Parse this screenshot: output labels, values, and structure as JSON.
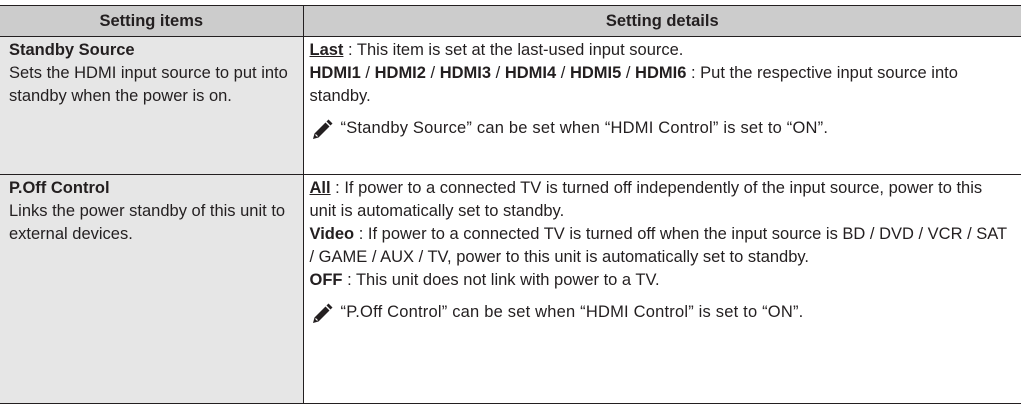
{
  "header": {
    "col_items": "Setting items",
    "col_details": "Setting details"
  },
  "rows": [
    {
      "name": "Standby Source",
      "description": "Sets the HDMI input source to put into standby when the power is on.",
      "details": {
        "last_label": "Last",
        "last_text": " : This item is set at the last-used input source.",
        "hdmi_options": [
          "HDMI1",
          "HDMI2",
          "HDMI3",
          "HDMI4",
          "HDMI5",
          "HDMI6"
        ],
        "hdmi_separator": " / ",
        "hdmi_text": " : Put the respective input source into standby."
      },
      "note": "“Standby Source” can be set when “HDMI Control” is set to “ON”."
    },
    {
      "name": "P.Off Control",
      "description": "Links the power standby of this unit to external devices.",
      "details": {
        "all_label": "All",
        "all_text": " : If power to a connected TV is turned off independently of the input source, power to this unit is automatically set to standby.",
        "video_label": "Video",
        "video_text": " : If power to a connected TV is turned off when the input source is BD / DVD / VCR / SAT / GAME / AUX / TV, power to this unit is automatically set to standby.",
        "off_label": "OFF",
        "off_text": " : This unit does not link with power to a TV."
      },
      "note": "“P.Off Control” can be set when “HDMI Control” is set to “ON”."
    }
  ],
  "icons": {
    "note_icon": "pencil-note-icon"
  },
  "colors": {
    "header_bg": "#cccccc",
    "item_bg": "#e6e6e6",
    "text": "#231f20"
  }
}
